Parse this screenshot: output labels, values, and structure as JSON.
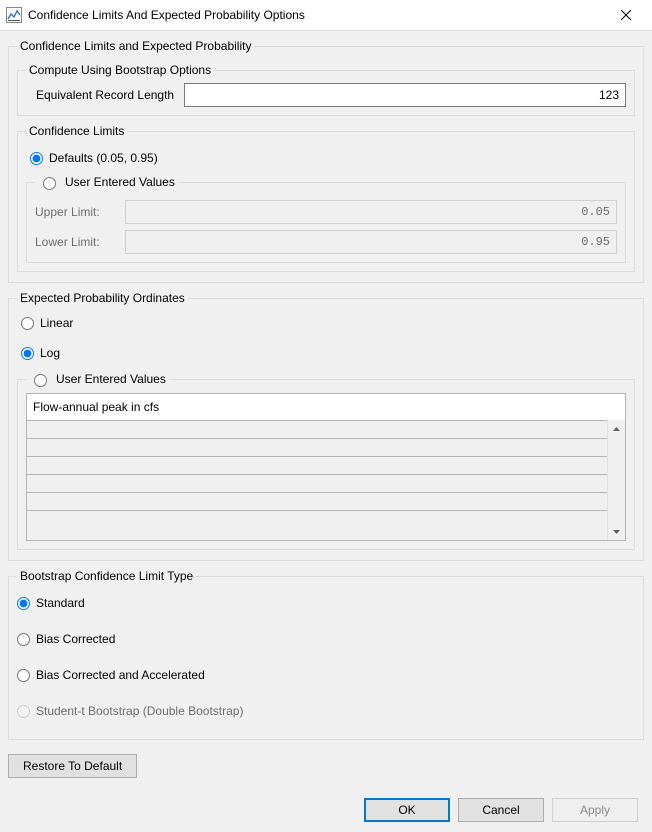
{
  "window": {
    "title": "Confidence Limits And Expected Probability Options"
  },
  "groups": {
    "main": "Confidence Limits and Expected Probability",
    "bootstrap": "Compute Using Bootstrap Options",
    "limits": "Confidence Limits",
    "user_limits": "User Entered Values",
    "ordinates": "Expected Probability Ordinates",
    "user_ordinates": "User Entered Values",
    "boot_type": "Bootstrap Confidence Limit Type"
  },
  "bootstrap": {
    "erl_label": "Equivalent Record Length",
    "erl_value": "123"
  },
  "limits": {
    "defaults_label": "Defaults (0.05, 0.95)",
    "user_label": "User Entered Values",
    "upper_label": "Upper Limit:",
    "upper_value": "0.05",
    "lower_label": "Lower Limit:",
    "lower_value": "0.95"
  },
  "ordinates": {
    "linear_label": "Linear",
    "log_label": "Log",
    "user_label": "User Entered Values",
    "table_header": "Flow-annual peak in cfs"
  },
  "boot_type": {
    "standard": "Standard",
    "bias": "Bias Corrected",
    "bias_acc": "Bias Corrected and Accelerated",
    "student_t": "Student-t Bootstrap (Double Bootstrap)"
  },
  "buttons": {
    "restore": "Restore To Default",
    "ok": "OK",
    "cancel": "Cancel",
    "apply": "Apply"
  }
}
